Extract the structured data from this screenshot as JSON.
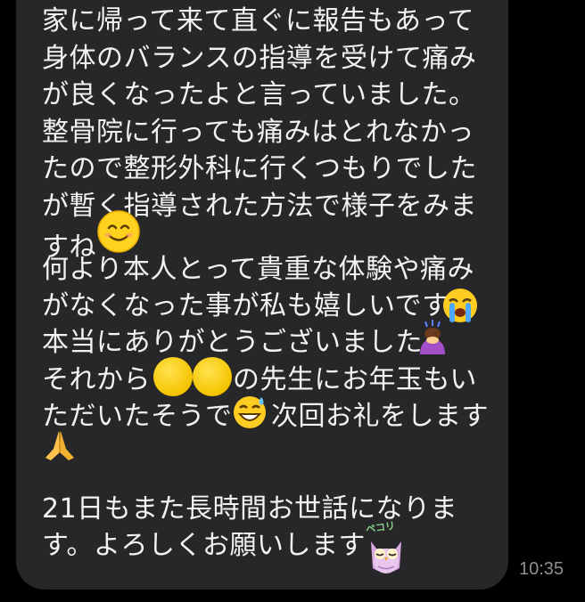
{
  "message": {
    "lines": [
      "家に帰って来て直ぐに報告もあって",
      "身体のバランスの指導を受けて痛み",
      "が良くなったよと言っていました。",
      "整骨院に行っても痛みはとれなかっ",
      "たので整形外科に行くつもりでした",
      "が暫く指導された方法で様子をみま",
      "すね",
      "何より本人とって貴重な体験や痛み",
      "がなくなった事が私も嬉しいです",
      "本当にありがとうございました",
      "それから",
      "の先生にお年玉もい",
      "ただいたそうで",
      "次回お礼をします",
      "",
      "21日もまた長時間お世話になりま",
      "す。よろしくお願いします"
    ],
    "sticker_text": "ペコリ",
    "time": "10:35"
  },
  "icons": {
    "smile": "smiling-face-icon",
    "cry": "loudly-crying-face-icon",
    "bow": "person-bowing-icon",
    "sweat": "grinning-face-with-sweat-icon",
    "pray": "folded-hands-icon",
    "owl": "owl-sticker-icon"
  },
  "colors": {
    "background": "#000000",
    "bubble": "#272729",
    "text": "#f2f2f2",
    "time": "#8e8e93"
  }
}
